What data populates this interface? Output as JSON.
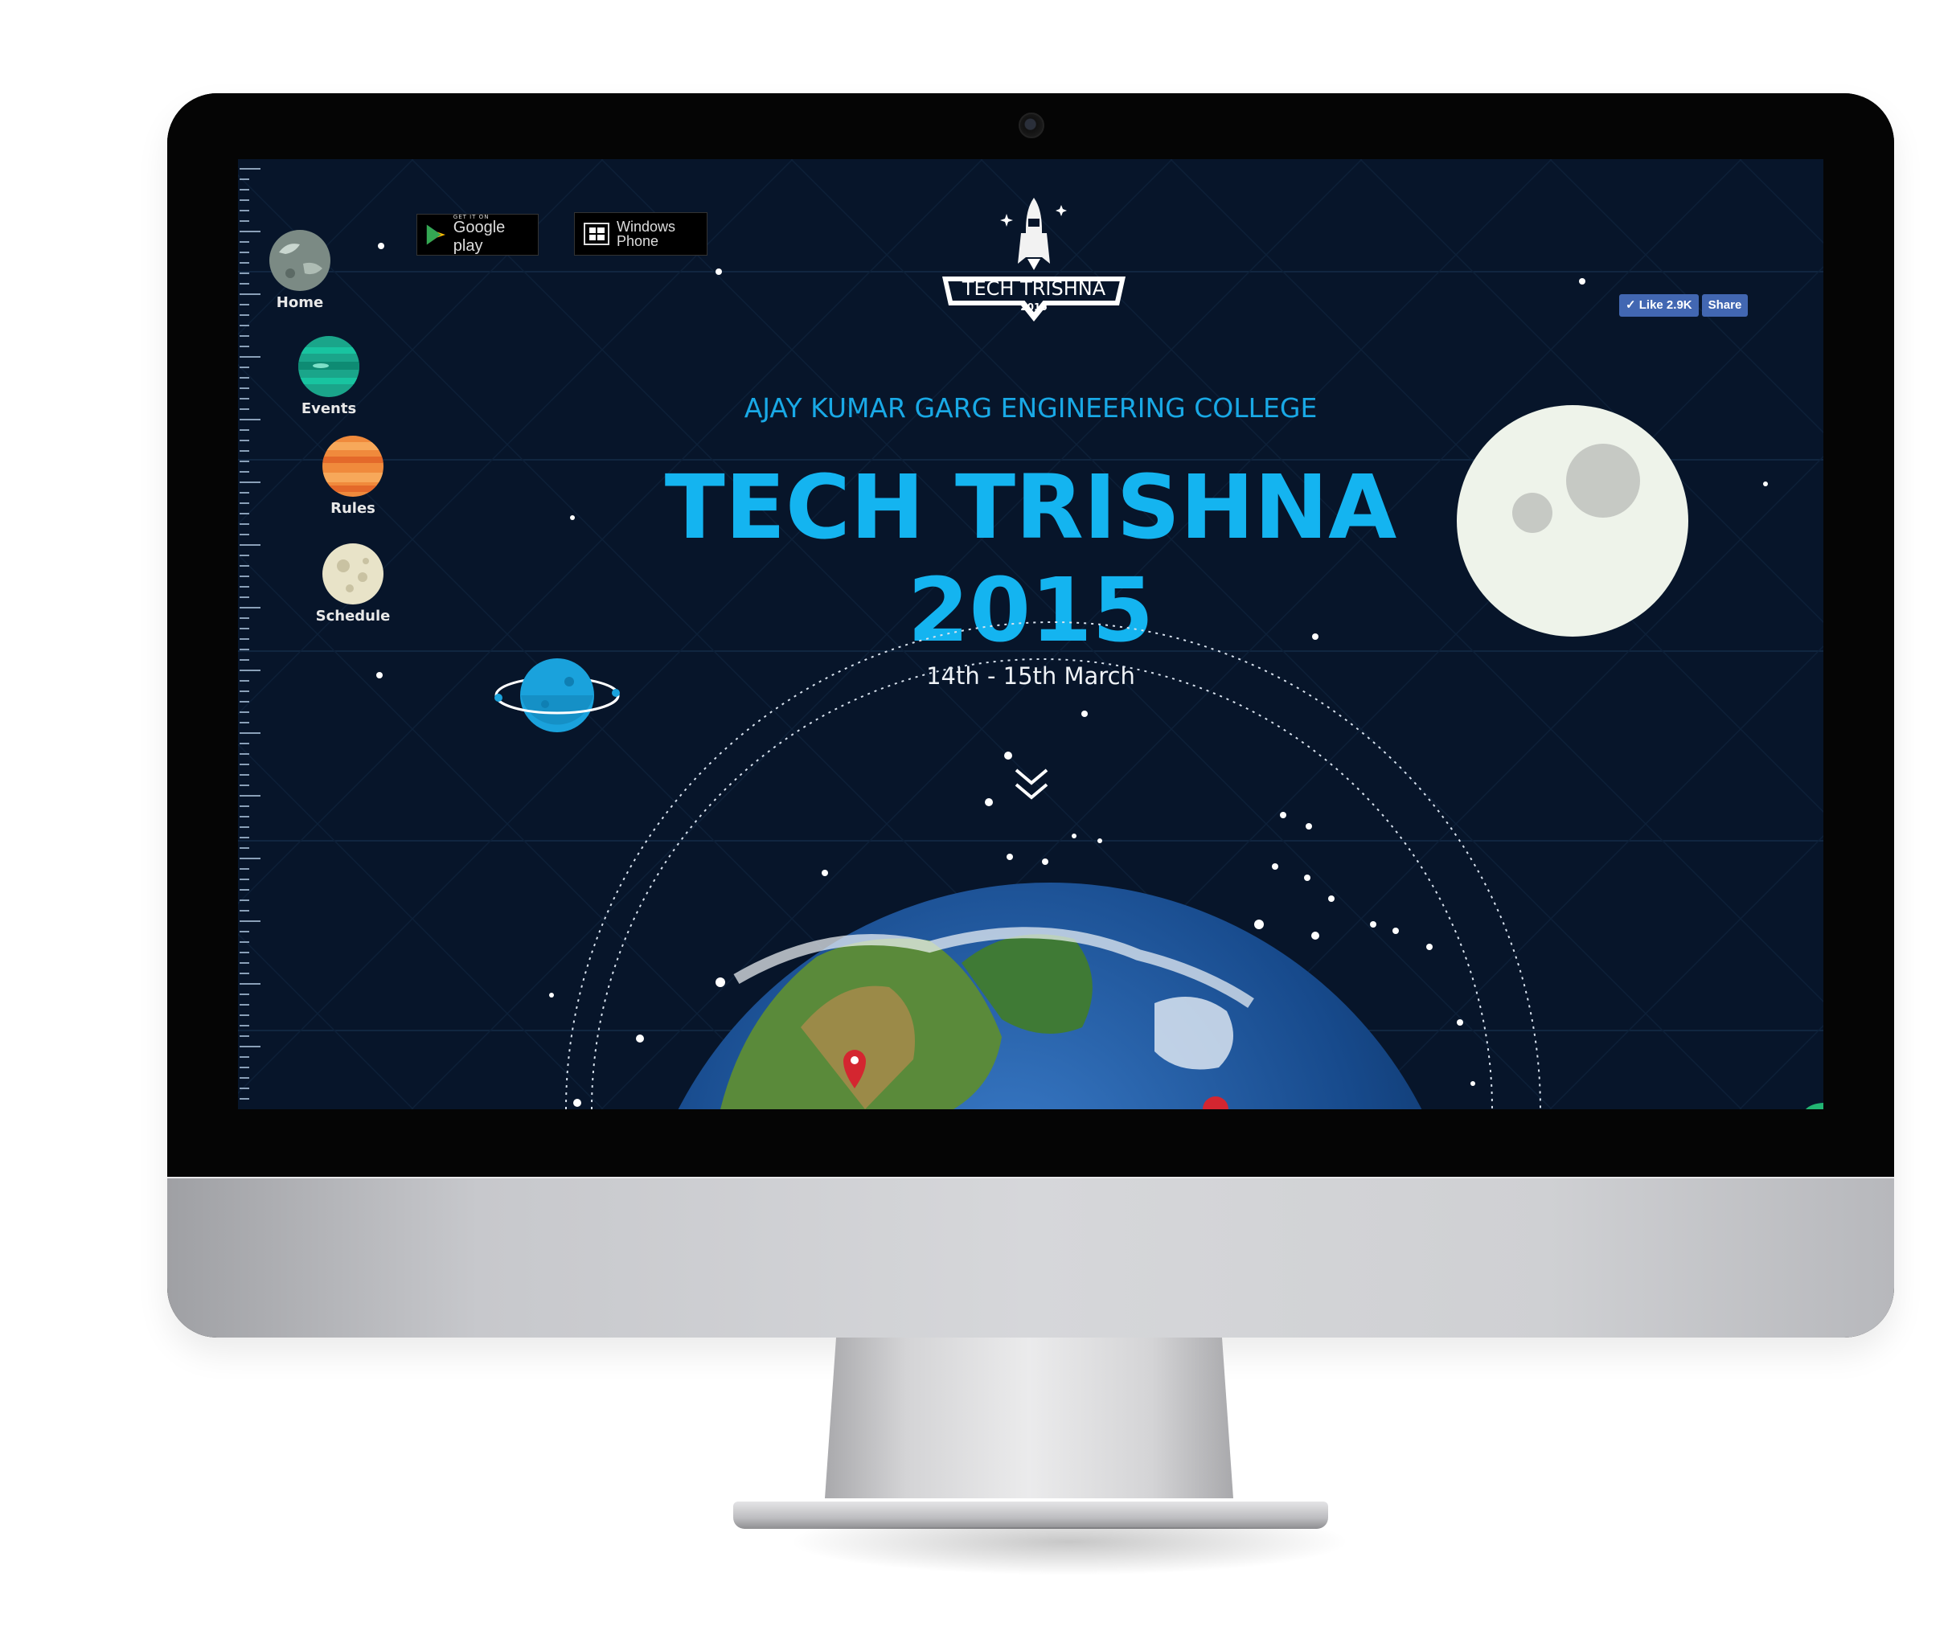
{
  "nav": {
    "items": [
      {
        "label": "Home",
        "icon": "planet-gray-icon"
      },
      {
        "label": "Events",
        "icon": "planet-green-icon"
      },
      {
        "label": "Rules",
        "icon": "planet-orange-icon"
      },
      {
        "label": "Schedule",
        "icon": "planet-moon-icon"
      }
    ]
  },
  "stores": {
    "google_small": "GET IT ON",
    "google_big": "Google play",
    "windows_line1": "Windows",
    "windows_line2": "Phone"
  },
  "facebook": {
    "like_label": "Like 2.9K",
    "share_label": "Share"
  },
  "logo": {
    "title": "TECH TRISHNA",
    "year": "2015"
  },
  "hero": {
    "college": "AJAY KUMAR GARG ENGINEERING COLLEGE",
    "title_line1": "TECH TRISHNA",
    "title_line2": "2015",
    "dates": "14th - 15th March"
  },
  "colors": {
    "background": "#07152a",
    "accent": "#14b4f0",
    "facebook": "#4267b2"
  }
}
